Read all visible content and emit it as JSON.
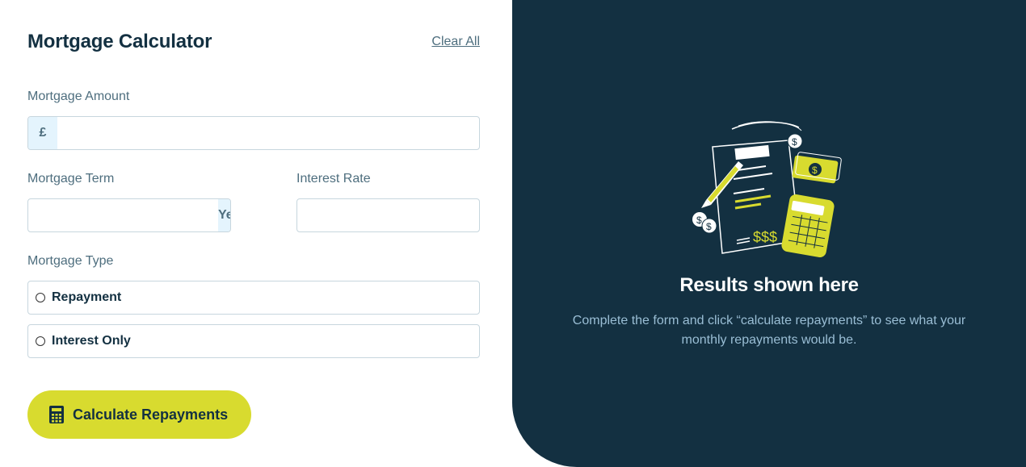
{
  "form": {
    "title": "Mortgage Calculator",
    "clear_label": "Clear All",
    "amount": {
      "label": "Mortgage Amount",
      "prefix": "£",
      "value": "",
      "placeholder": ""
    },
    "term": {
      "label": "Mortgage Term",
      "suffix": "Years",
      "value": "",
      "placeholder": ""
    },
    "rate": {
      "label": "Interest Rate",
      "suffix": "%",
      "value": "",
      "placeholder": ""
    },
    "type": {
      "label": "Mortgage Type",
      "options": [
        {
          "label": "Repayment",
          "selected": false
        },
        {
          "label": "Interest Only",
          "selected": false
        }
      ]
    },
    "submit_label": "Calculate Repayments",
    "submit_icon": "calculator-icon"
  },
  "results": {
    "illustration": "empty-results-illustration",
    "title": "Results shown here",
    "description": "Complete the form and click “calculate repayments” to see what your monthly repayments would be."
  },
  "colors": {
    "navy": "#133041",
    "lime": "#d8db2f",
    "slate": "#4e6e7e",
    "affix_bg": "#e4f4fd",
    "border": "#c7d6de",
    "desc_text": "#9abed5"
  }
}
